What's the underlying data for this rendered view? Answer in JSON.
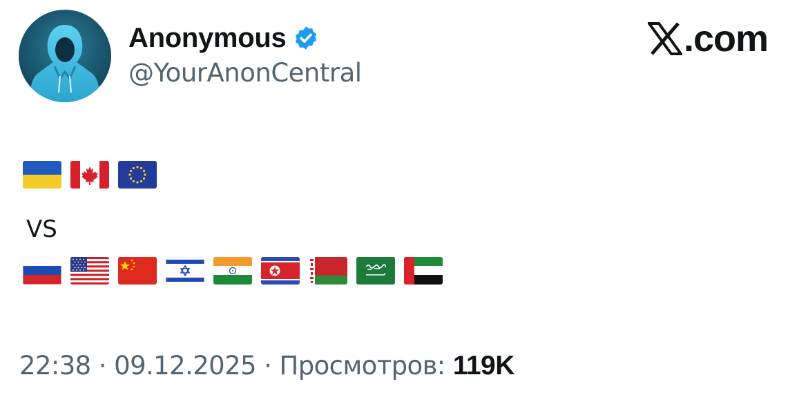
{
  "tweet": {
    "author": {
      "display_name": "Anonymous",
      "handle": "@YourAnonCentral",
      "verified": true,
      "verified_icon": "verified-badge-icon",
      "avatar_icon": "hooded-figure-avatar"
    },
    "brand": {
      "icon": "x-logo-icon",
      "suffix": ".com"
    },
    "content": {
      "line1_flags": [
        "ukraine",
        "canada",
        "european-union"
      ],
      "separator": "VS",
      "line2_flags": [
        "russia",
        "united-states",
        "china",
        "israel",
        "india",
        "north-korea",
        "belarus",
        "saudi-arabia",
        "united-arab-emirates"
      ]
    },
    "meta": {
      "time": "22:38",
      "dot1": " · ",
      "date": "09.12.2025",
      "dot2": " · ",
      "views_label": "Просмотров: ",
      "views_count": "119K"
    }
  },
  "colors": {
    "text_primary": "#0f1419",
    "text_secondary": "#536471",
    "verified_blue": "#1d9bf0",
    "avatar_bg": "#1a5b73",
    "avatar_figure": "#3bb8e0"
  }
}
